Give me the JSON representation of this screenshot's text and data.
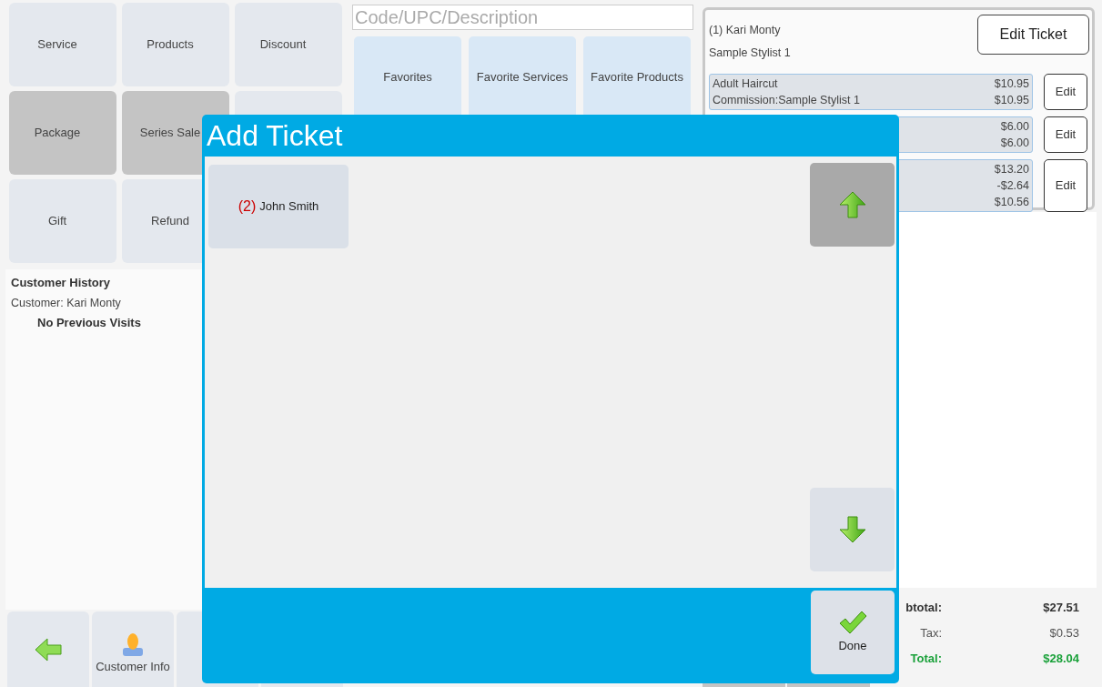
{
  "menu_buttons": [
    {
      "label": "Service",
      "highlighted": false
    },
    {
      "label": "Products",
      "highlighted": false
    },
    {
      "label": "Discount",
      "highlighted": false
    },
    {
      "label": "Package",
      "highlighted": true
    },
    {
      "label": "Series Sale",
      "highlighted": true
    },
    {
      "highlighted": false
    },
    {
      "label": "Gift",
      "highlighted": false
    },
    {
      "label": "Refund",
      "highlighted": false
    }
  ],
  "customer_history": {
    "title": "Customer History",
    "customer": "Customer: Kari Monty",
    "note": "No Previous Visits"
  },
  "bottom_buttons": [
    {
      "kind": "back"
    },
    {
      "kind": "customer",
      "label": "Customer Info"
    },
    {
      "kind": "blank"
    },
    {
      "kind": "blank"
    }
  ],
  "search": {
    "placeholder": "Code/UPC/Description"
  },
  "favorite_tabs": [
    {
      "label": "Favorites"
    },
    {
      "label": "Favorite Services"
    },
    {
      "label": "Favorite Products"
    }
  ],
  "ticket": {
    "customer": "(1) Kari Monty",
    "stylist": "Sample Stylist 1",
    "edit_button": "Edit Ticket",
    "items": [
      {
        "lines": [
          {
            "label": "Adult Haircut",
            "amount": "$10.95"
          },
          {
            "label": "Commission:Sample Stylist 1",
            "amount": "$10.95"
          }
        ],
        "button": "Edit"
      },
      {
        "lines": [
          {
            "amount": "$6.00"
          },
          {
            "amount": "$6.00"
          }
        ],
        "button": "Edit"
      },
      {
        "lines": [
          {
            "amount": "$13.20"
          },
          {
            "amount": "-$2.64"
          },
          {
            "amount": "$10.56"
          }
        ],
        "button": "Edit"
      }
    ]
  },
  "totals": [
    {
      "kind": "subtotal",
      "label": "btotal:",
      "value": "$27.51"
    },
    {
      "kind": "tax",
      "label": "Tax:",
      "value": "$0.53"
    },
    {
      "kind": "total",
      "label": "Total:",
      "value": "$28.04"
    }
  ],
  "dialog": {
    "title": "Add Ticket",
    "tickets": [
      {
        "number": "(2)",
        "name": "John Smith"
      }
    ],
    "done_button": "Done"
  }
}
